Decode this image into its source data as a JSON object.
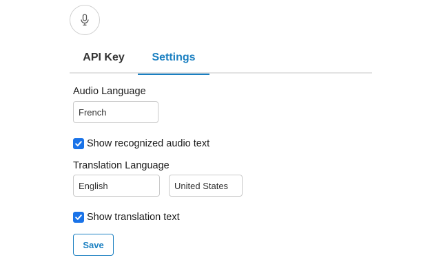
{
  "mic": {
    "icon": "microphone-icon"
  },
  "tabs": [
    {
      "label": "API Key",
      "active": false
    },
    {
      "label": "Settings",
      "active": true
    }
  ],
  "audio_language": {
    "label": "Audio Language",
    "value": "French"
  },
  "show_recognized": {
    "label": "Show recognized audio text",
    "checked": true
  },
  "translation_language": {
    "label": "Translation Language",
    "language_value": "English",
    "region_value": "United States"
  },
  "show_translation": {
    "label": "Show translation text",
    "checked": true
  },
  "save_label": "Save",
  "colors": {
    "accent": "#1a7fc1",
    "checkbox": "#1a73e8"
  }
}
